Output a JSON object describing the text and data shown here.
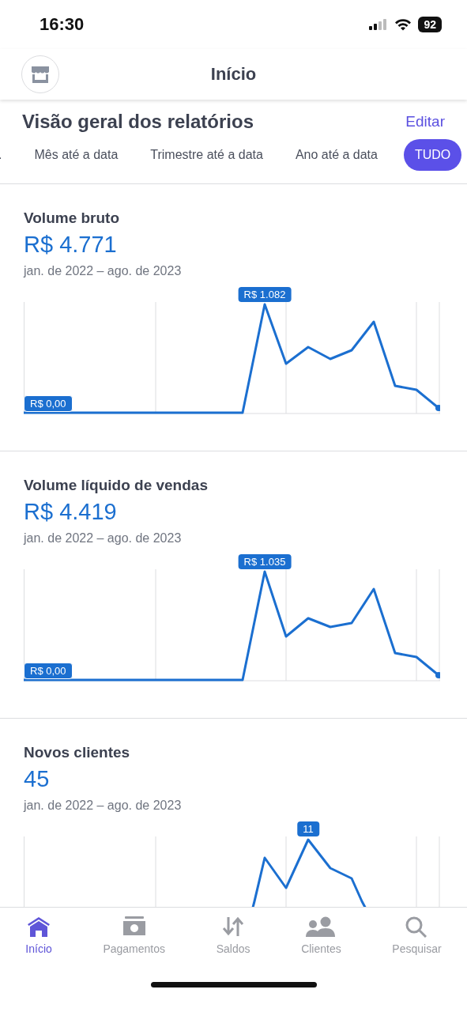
{
  "status_bar": {
    "time": "16:30",
    "battery": "92"
  },
  "header": {
    "title": "Início"
  },
  "section": {
    "title": "Visão geral dos relatórios",
    "action": "Editar"
  },
  "tabs": [
    {
      "label": ".",
      "selected": false
    },
    {
      "label": "Mês até a data",
      "selected": false
    },
    {
      "label": "Trimestre até a data",
      "selected": false
    },
    {
      "label": "Ano até a data",
      "selected": false
    },
    {
      "label": "TUDO",
      "selected": true
    }
  ],
  "cards": [
    {
      "title": "Volume bruto",
      "amount": "R$ 4.771",
      "period": "jan. de 2022 – ago. de 2023",
      "peak_label": "R$ 1.082",
      "zero_label": "R$ 0,00"
    },
    {
      "title": "Volume líquido de vendas",
      "amount": "R$ 4.419",
      "period": "jan. de 2022 – ago. de 2023",
      "peak_label": "R$ 1.035",
      "zero_label": "R$ 0,00"
    },
    {
      "title": "Novos clientes",
      "amount": "45",
      "period": "jan. de 2022 – ago. de 2023",
      "peak_label": "11"
    }
  ],
  "tab_bar": [
    {
      "label": "Início",
      "kind": "home",
      "selected": true
    },
    {
      "label": "Pagamentos",
      "kind": "payments",
      "selected": false
    },
    {
      "label": "Saldos",
      "kind": "balances",
      "selected": false
    },
    {
      "label": "Clientes",
      "kind": "customers",
      "selected": false
    },
    {
      "label": "Pesquisar",
      "kind": "search",
      "selected": false
    }
  ]
}
